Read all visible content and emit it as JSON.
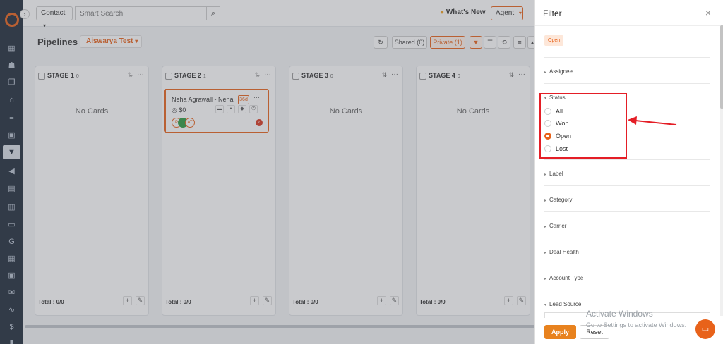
{
  "topbar": {
    "contact_label": "Contact",
    "search_placeholder": "Smart Search",
    "whats_new": "What's New",
    "agent_label": "Agent"
  },
  "toolbar": {
    "title": "Pipelines",
    "pipeline_name": "Aiswarya Test",
    "shared_label": "Shared (6)",
    "private_label": "Private (1)"
  },
  "board": {
    "columns": [
      {
        "title": "STAGE 1",
        "count": "0",
        "empty": "No Cards",
        "total": "Total : 0/0"
      },
      {
        "title": "STAGE 2",
        "count": "1",
        "empty": "",
        "total": "Total : 0/0"
      },
      {
        "title": "STAGE 3",
        "count": "0",
        "empty": "No Cards",
        "total": "Total : 0/0"
      },
      {
        "title": "STAGE 4",
        "count": "0",
        "empty": "No Cards",
        "total": "Total : 0/0"
      }
    ],
    "card": {
      "name": "Neha Agrawall - Neha",
      "days": "36d",
      "amount": "$0",
      "tag_p": "P",
      "tag_at": "AT"
    }
  },
  "filter": {
    "title": "Filter",
    "active_chip": "Open",
    "sections": {
      "assignee": "Assignee",
      "status": "Status",
      "label": "Label",
      "category": "Category",
      "carrier": "Carrier",
      "deal_health": "Deal Health",
      "account_type": "Account Type",
      "lead_source": "Lead Source"
    },
    "status_options": [
      {
        "label": "All",
        "checked": false
      },
      {
        "label": "Won",
        "checked": false
      },
      {
        "label": "Open",
        "checked": true
      },
      {
        "label": "Lost",
        "checked": false
      }
    ],
    "apply_label": "Apply",
    "reset_label": "Reset"
  },
  "watermark": {
    "line1": "Activate Windows",
    "line2": "Go to Settings to activate Windows."
  },
  "colors": {
    "accent": "#e8621a",
    "annotation": "#e41e26",
    "sidebar": "#1e2a3a"
  }
}
